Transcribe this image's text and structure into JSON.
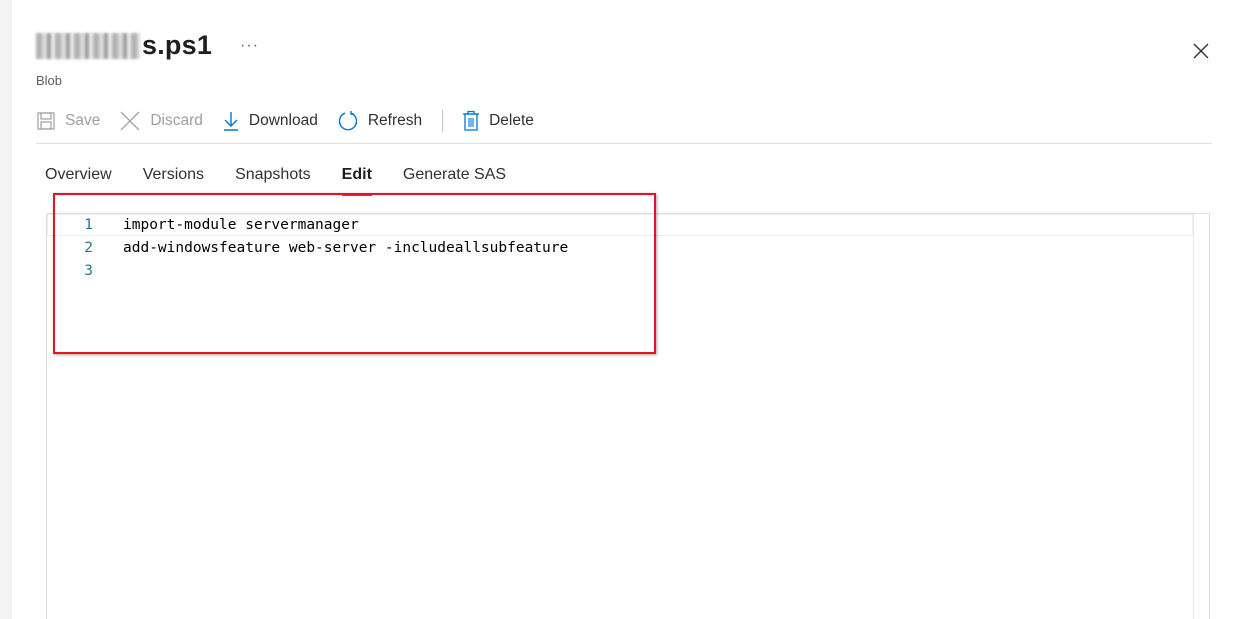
{
  "header": {
    "title_suffix": "s.ps1",
    "more_label": "···",
    "subtitle": "Blob"
  },
  "toolbar": {
    "save_label": "Save",
    "discard_label": "Discard",
    "download_label": "Download",
    "refresh_label": "Refresh",
    "delete_label": "Delete"
  },
  "tabs": [
    {
      "label": "Overview"
    },
    {
      "label": "Versions"
    },
    {
      "label": "Snapshots"
    },
    {
      "label": "Edit",
      "active": true
    },
    {
      "label": "Generate SAS"
    }
  ],
  "editor": {
    "lines": [
      {
        "num": "1",
        "text": "import-module servermanager"
      },
      {
        "num": "2",
        "text": "add-windowsfeature web-server -includeallsubfeature"
      },
      {
        "num": "3",
        "text": ""
      }
    ]
  },
  "colors": {
    "accent": "#0078d4",
    "highlight": "#e81123",
    "line_number": "#237893"
  },
  "icons": {
    "save": "save-icon",
    "discard": "close-icon",
    "download": "download-icon",
    "refresh": "refresh-icon",
    "delete": "trash-icon",
    "close": "close-icon"
  }
}
